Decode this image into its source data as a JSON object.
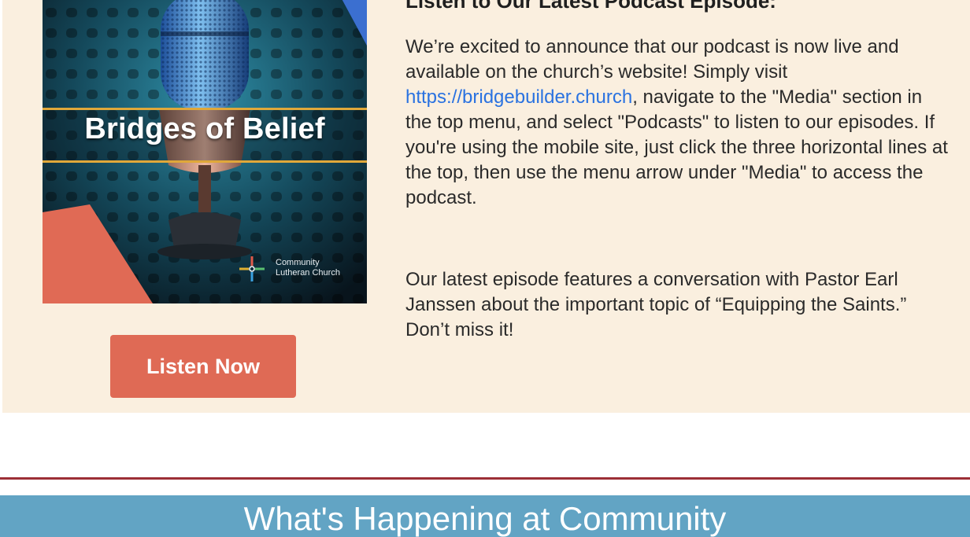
{
  "podcast": {
    "cover": {
      "title": "Bridges of Belief",
      "brand_line_1": "Community",
      "brand_line_2": "Lutheran Church",
      "image_icon": "microphone-icon",
      "logo_icon": "cross-logo-icon"
    },
    "listen_button_label": "Listen Now",
    "heading": "Listen to Our Latest Podcast Episode:",
    "paragraph_1": {
      "before_link": "We’re excited to announce that our podcast is now live and available on the church’s website! Simply visit ",
      "link_text": "https://bridgebuilder.church",
      "after_link": ", navigate to the \"Media\" section in the top menu, and select \"Podcasts\" to listen to our episodes. If you're using the mobile site, just click the three horizontal lines at the top, then use the menu arrow under \"Media\" to access the podcast."
    },
    "paragraph_2": "Our latest episode features a conversation with Pastor Earl Janssen about the important topic of “Equipping the Saints.” Don’t miss it!"
  },
  "section": {
    "title": "What's Happening at Community"
  },
  "colors": {
    "panel_background": "#faefdf",
    "button": "#df6a55",
    "link": "#2a72e0",
    "divider": "#9c2f36",
    "section_banner": "#62a4c4"
  }
}
